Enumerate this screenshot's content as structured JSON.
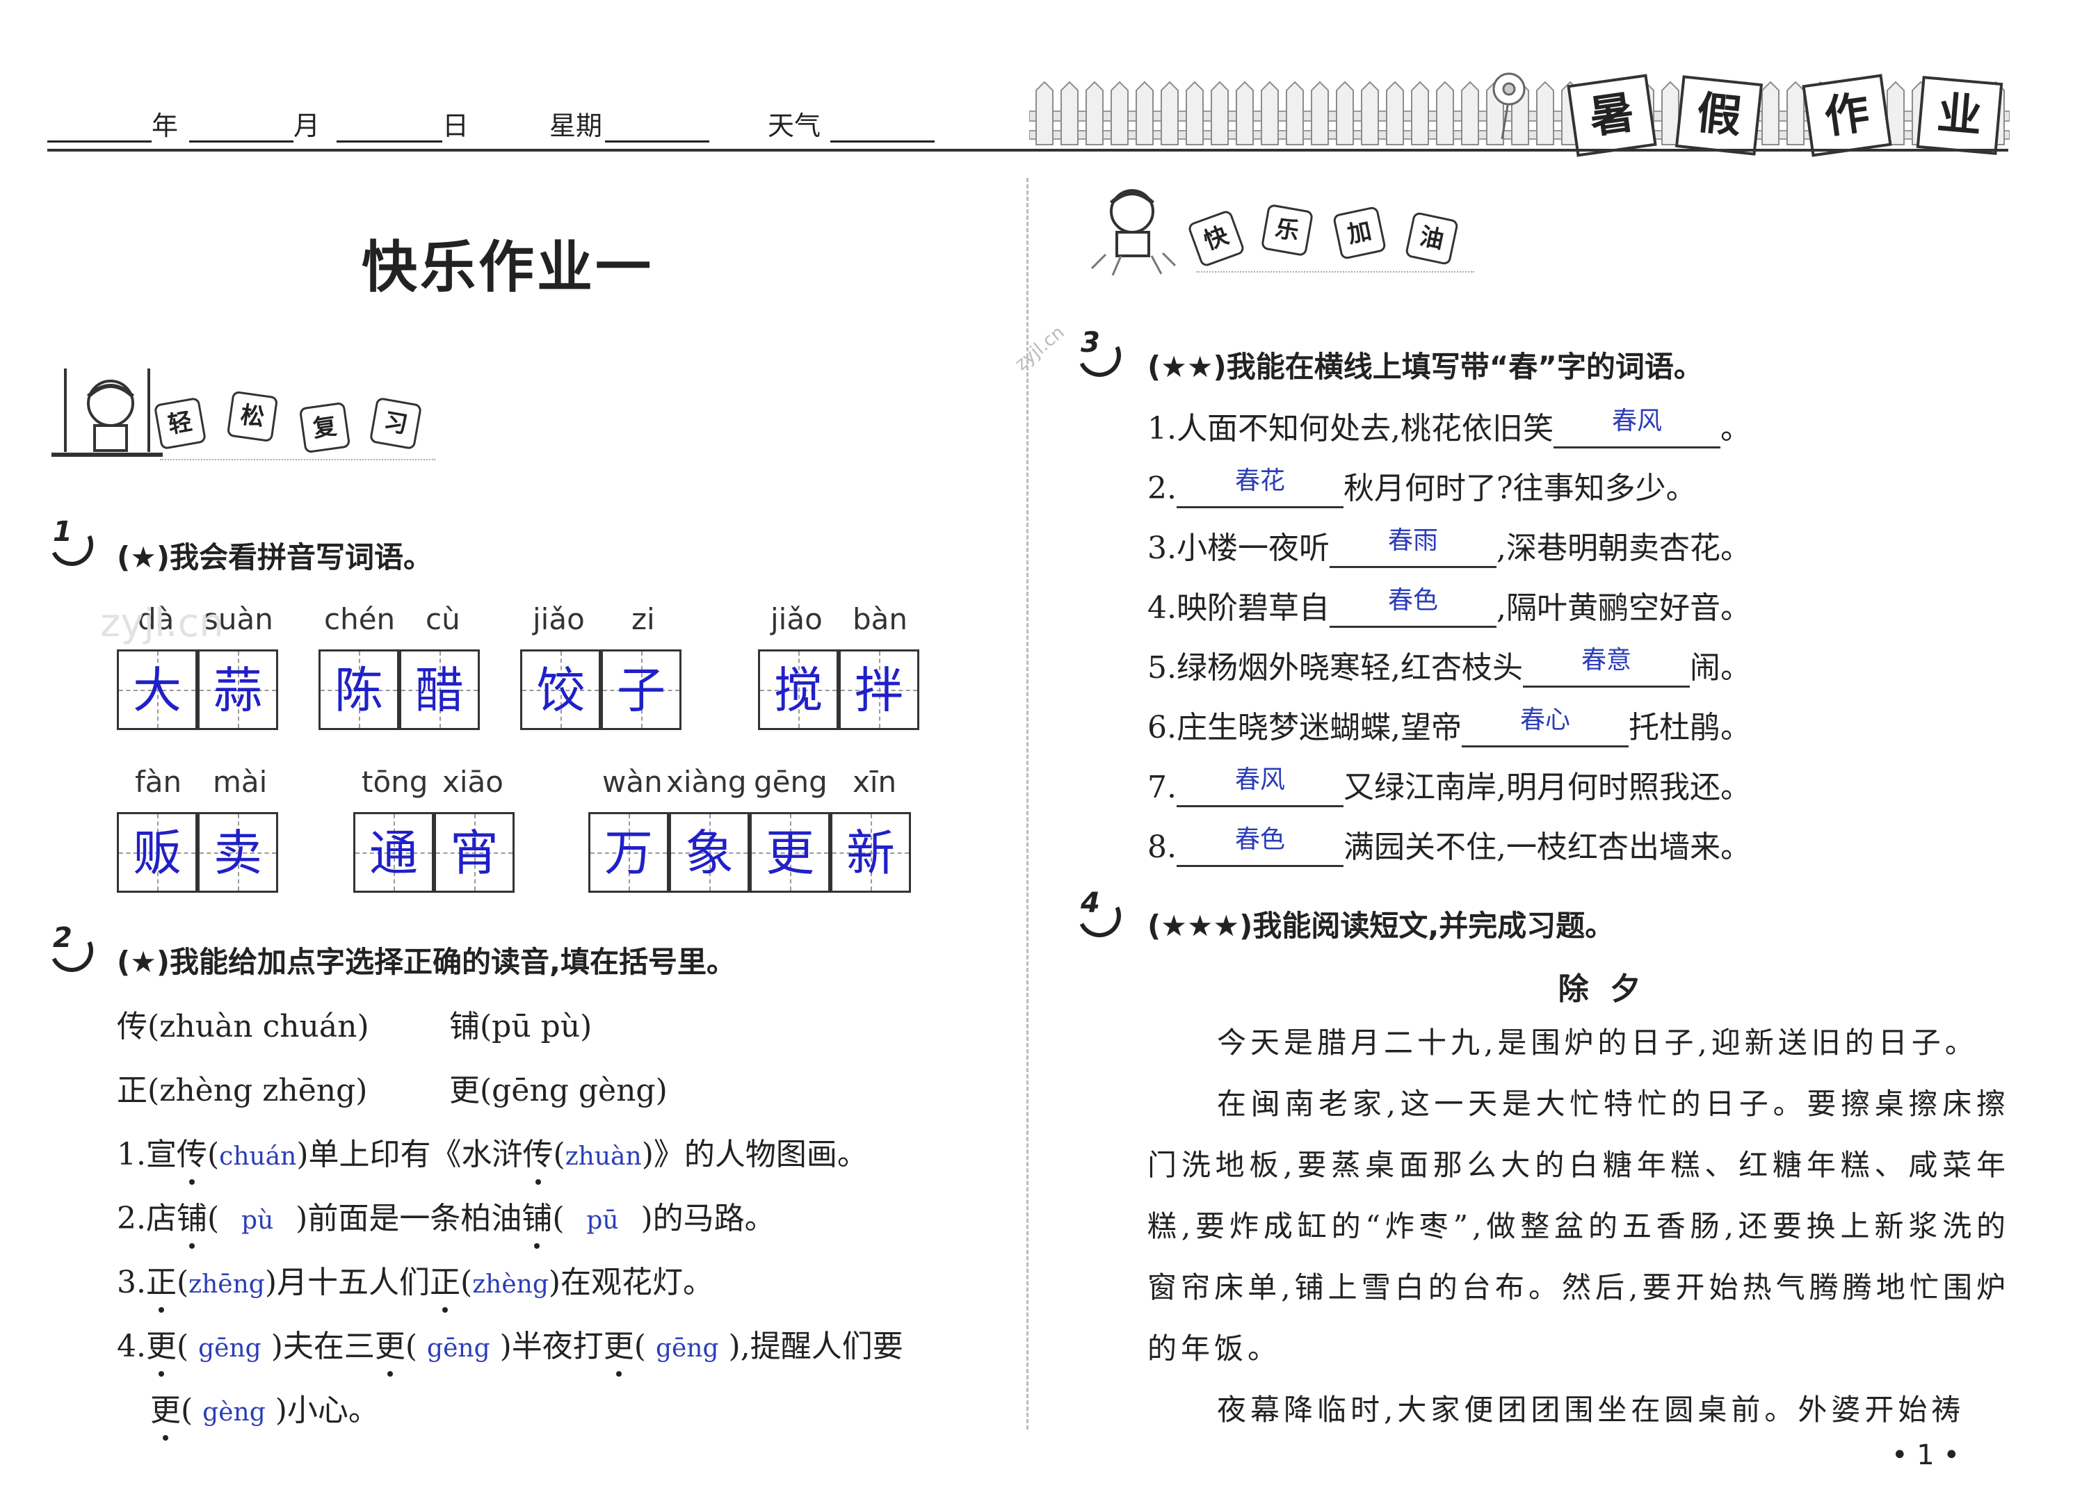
{
  "header": {
    "year_label": "年",
    "month_label": "月",
    "day_label": "日",
    "weekday_label": "星期",
    "weather_label": "天气",
    "banner_chars": [
      "暑",
      "假",
      "作",
      "业"
    ]
  },
  "left": {
    "title": "快乐作业一",
    "section_badge": [
      "轻",
      "松",
      "复",
      "习"
    ],
    "q1": {
      "num": "1",
      "heading": "(★)我会看拼音写词语。",
      "groups": [
        {
          "pinyin": [
            "dà",
            "suàn"
          ],
          "answers": [
            "大",
            "蒜"
          ]
        },
        {
          "pinyin": [
            "chén",
            "cù"
          ],
          "answers": [
            "陈",
            "醋"
          ]
        },
        {
          "pinyin": [
            "jiǎo",
            "zi"
          ],
          "answers": [
            "饺",
            "子"
          ]
        },
        {
          "pinyin": [
            "jiǎo",
            "bàn"
          ],
          "answers": [
            "搅",
            "拌"
          ]
        },
        {
          "pinyin": [
            "fàn",
            "mài"
          ],
          "answers": [
            "贩",
            "卖"
          ]
        },
        {
          "pinyin": [
            "tōng",
            "xiāo"
          ],
          "answers": [
            "通",
            "宵"
          ]
        },
        {
          "pinyin": [
            "wàn",
            "xiàng",
            "gēng",
            "xīn"
          ],
          "answers": [
            "万",
            "象",
            "更",
            "新"
          ]
        }
      ]
    },
    "q2": {
      "num": "2",
      "heading": "(★)我能给加点字选择正确的读音,填在括号里。",
      "options": [
        "传(zhuàn chuán)",
        "铺(pū pù)",
        "正(zhèng zhēng)",
        "更(gēng gèng)"
      ],
      "items": [
        {
          "no": "1.",
          "p1": "宣",
          "d1": "传",
          "a1": "chuán",
          "p2": "单上印有《水浒",
          "d2": "传",
          "a2": "zhuàn",
          "p3": "》的人物图画。"
        },
        {
          "no": "2.",
          "p1": "店",
          "d1": "铺",
          "a1": "pù",
          "p2": "前面是一条柏油",
          "d2": "铺",
          "a2": "pū",
          "p3": "的马路。"
        },
        {
          "no": "3.",
          "p1": "",
          "d1": "正",
          "a1": "zhēng",
          "p2": "月十五人们",
          "d2": "正",
          "a2": "zhèng",
          "p3": "在观花灯。"
        },
        {
          "no": "4.",
          "p1": "",
          "d1": "更",
          "a1": "gēng",
          "p2": "夫在三",
          "d2": "更",
          "a2": "gēng",
          "p3": "半夜打",
          "d3": "更",
          "a3": "gēng",
          "p4": ",提醒人们要"
        },
        {
          "cont_d": "更",
          "cont_a": "gèng",
          "cont_tail": "小心。"
        }
      ]
    }
  },
  "right": {
    "section_badge": [
      "快",
      "乐",
      "加",
      "油"
    ],
    "watermark": "zyjl.cn",
    "q3": {
      "num": "3",
      "heading": "(★★)我能在横线上填写带“春”字的词语。",
      "items": [
        {
          "pre": "1.人面不知何处去,桃花依旧笑",
          "answer": "春风",
          "post": "。"
        },
        {
          "pre": "2.",
          "answer": "春花",
          "post": "秋月何时了?往事知多少。"
        },
        {
          "pre": "3.小楼一夜听",
          "answer": "春雨",
          "post": ",深巷明朝卖杏花。"
        },
        {
          "pre": "4.映阶碧草自",
          "answer": "春色",
          "post": ",隔叶黄鹂空好音。"
        },
        {
          "pre": "5.绿杨烟外晓寒轻,红杏枝头",
          "answer": "春意",
          "post": "闹。"
        },
        {
          "pre": "6.庄生晓梦迷蝴蝶,望帝",
          "answer": "春心",
          "post": "托杜鹃。"
        },
        {
          "pre": "7.",
          "answer": "春风",
          "post": "又绿江南岸,明月何时照我还。"
        },
        {
          "pre": "8.",
          "answer": "春色",
          "post": "满园关不住,一枝红杏出墙来。"
        }
      ]
    },
    "q4": {
      "num": "4",
      "heading": "(★★★)我能阅读短文,并完成习题。",
      "passage_title": "除  夕",
      "paragraphs": [
        "今天是腊月二十九,是围炉的日子,迎新送旧的日子。",
        "在闽南老家,这一天是大忙特忙的日子。要擦桌擦床擦门洗地板,要蒸桌面那么大的白糖年糕、红糖年糕、咸菜年糕,要炸成缸的“炸枣”,做整盆的五香肠,还要换上新浆洗的窗帘床单,铺上雪白的台布。然后,要开始热气腾腾地忙围炉的年饭。",
        "夜幕降临时,大家便团团围坐在圆桌前。外婆开始祷"
      ]
    }
  },
  "footer": {
    "page": "• 1 •"
  },
  "watermark_left": "zyjl.cn"
}
